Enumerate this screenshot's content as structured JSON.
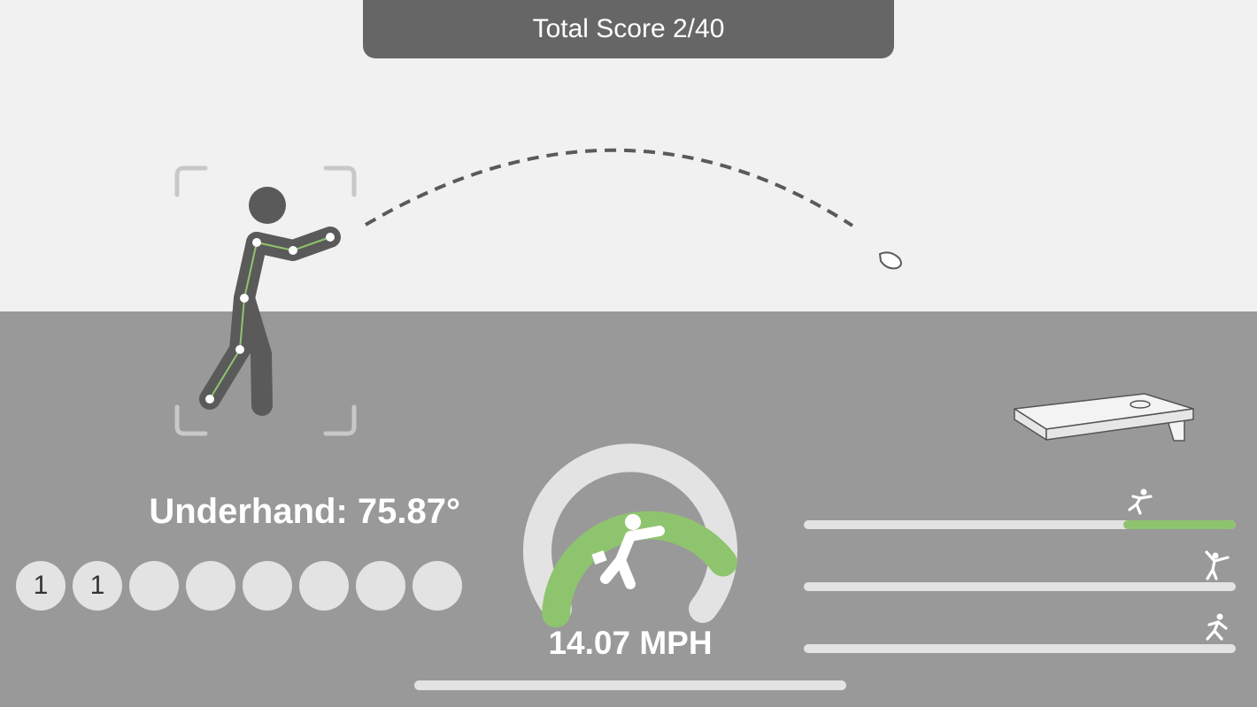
{
  "header": {
    "total_score": "Total Score 2/40"
  },
  "throw": {
    "type_label": "Underhand: 75.87°",
    "speed_label": "14.07 MPH",
    "speed_gauge_fraction": 0.5,
    "round_scores": [
      "1",
      "1",
      "",
      "",
      "",
      "",
      "",
      ""
    ]
  },
  "throw_bars": [
    {
      "icon": "underhand-throw-icon",
      "fill_fraction": 0.26,
      "fill_side": "right"
    },
    {
      "icon": "overhand-throw-icon",
      "fill_fraction": 0,
      "fill_side": "right"
    },
    {
      "icon": "sidearm-throw-icon",
      "fill_fraction": 0,
      "fill_side": "right"
    }
  ],
  "colors": {
    "sky": "#f1f1f1",
    "ground": "#999999",
    "banner": "#666666",
    "accent_green": "#8fc46e",
    "track": "#e3e3e3",
    "figure": "#5a5a5a"
  }
}
